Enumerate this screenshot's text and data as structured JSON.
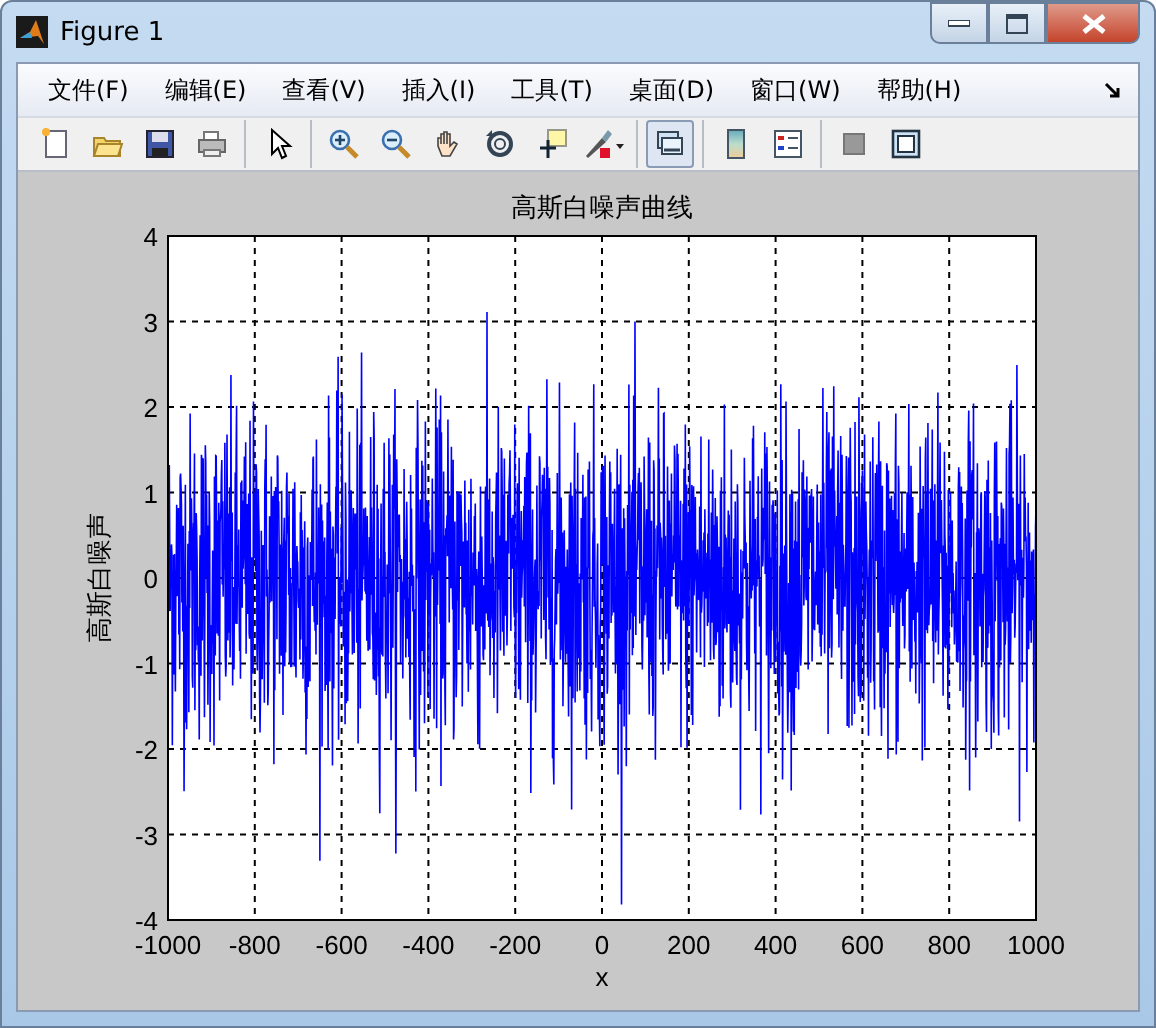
{
  "window": {
    "title": "Figure 1"
  },
  "menu": [
    {
      "label": "文件(F)"
    },
    {
      "label": "编辑(E)"
    },
    {
      "label": "查看(V)"
    },
    {
      "label": "插入(I)"
    },
    {
      "label": "工具(T)"
    },
    {
      "label": "桌面(D)"
    },
    {
      "label": "窗口(W)"
    },
    {
      "label": "帮助(H)"
    }
  ],
  "toolbar": [
    [
      {
        "kind": "new",
        "pressed": false
      },
      {
        "kind": "open",
        "pressed": false
      },
      {
        "kind": "save",
        "pressed": false
      },
      {
        "kind": "print",
        "pressed": false
      }
    ],
    [
      {
        "kind": "pointer",
        "pressed": false
      }
    ],
    [
      {
        "kind": "zoom-in",
        "pressed": false
      },
      {
        "kind": "zoom-out",
        "pressed": false
      },
      {
        "kind": "pan",
        "pressed": false
      },
      {
        "kind": "rotate",
        "pressed": false
      },
      {
        "kind": "data-cursor",
        "pressed": false
      },
      {
        "kind": "brush",
        "pressed": false
      }
    ],
    [
      {
        "kind": "link",
        "pressed": true
      }
    ],
    [
      {
        "kind": "colorbar",
        "pressed": false
      },
      {
        "kind": "legend",
        "pressed": false
      }
    ],
    [
      {
        "kind": "hide-tools",
        "pressed": false
      },
      {
        "kind": "dock",
        "pressed": false
      }
    ]
  ],
  "axes": {
    "title": "高斯白噪声曲线",
    "xlabel": "x",
    "ylabel": "高斯白噪声",
    "xticks": [
      "-1000",
      "-800",
      "-600",
      "-400",
      "-200",
      "0",
      "200",
      "400",
      "600",
      "800",
      "1000"
    ],
    "yticks": [
      "4",
      "3",
      "2",
      "1",
      "0",
      "-1",
      "-2",
      "-3",
      "-4"
    ]
  }
}
